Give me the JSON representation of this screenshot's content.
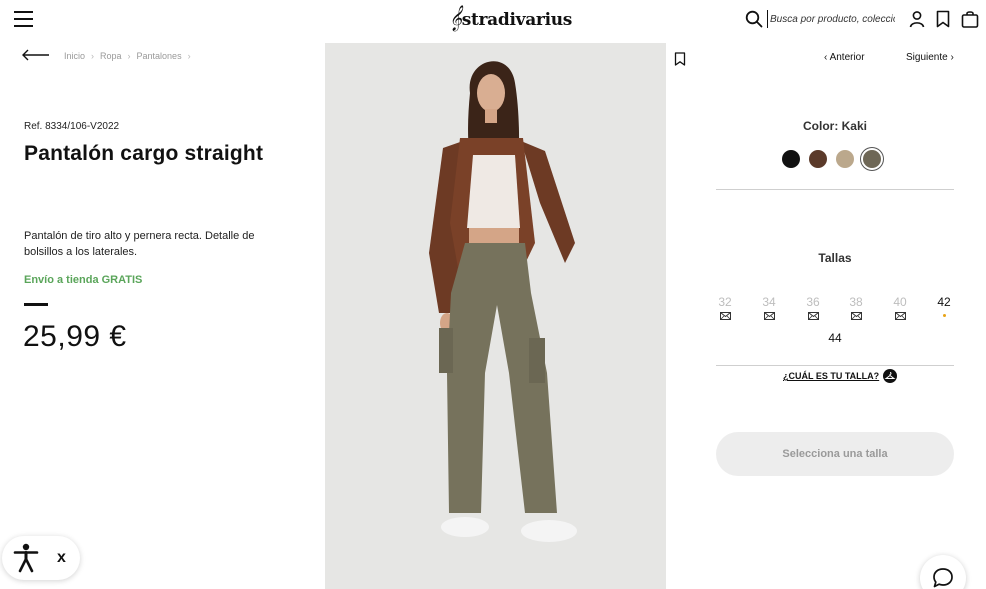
{
  "header": {
    "logo_text": "stradivarius",
    "logo_mark": "𝄞",
    "search_placeholder": "Busca por producto, colección..."
  },
  "breadcrumb": {
    "items": [
      "Inicio",
      "Ropa",
      "Pantalones"
    ]
  },
  "product": {
    "ref": "Ref. 8334/106-V2022",
    "title": "Pantalón cargo straight",
    "description": "Pantalón de tiro alto y pernera recta. Detalle de bolsillos a los laterales.",
    "shipping": "Envío a tienda GRATIS",
    "price": "25,99 €"
  },
  "navigation": {
    "prev_label": "Anterior",
    "next_label": "Siguiente"
  },
  "color": {
    "label": "Color: Kaki",
    "swatches": [
      {
        "name": "black",
        "hex": "#111111"
      },
      {
        "name": "brown",
        "hex": "#5b3a2a"
      },
      {
        "name": "beige",
        "hex": "#bba88c"
      },
      {
        "name": "kaki",
        "hex": "#6e6756",
        "selected": true
      }
    ]
  },
  "sizes": {
    "label": "Tallas",
    "items": [
      {
        "size": "32",
        "available": false,
        "icon": "mail-icon"
      },
      {
        "size": "34",
        "available": false,
        "icon": "mail-icon"
      },
      {
        "size": "36",
        "available": false,
        "icon": "mail-icon"
      },
      {
        "size": "38",
        "available": false,
        "icon": "mail-icon"
      },
      {
        "size": "40",
        "available": false,
        "icon": "mail-icon"
      },
      {
        "size": "42",
        "available": true,
        "icon": "low-stock-dot"
      },
      {
        "size": "44",
        "available": true,
        "icon": ""
      }
    ],
    "guide_label": "¿CUÁL ES TU TALLA?"
  },
  "cta": {
    "select_size_label": "Selecciona una talla"
  },
  "widgets": {
    "close_label": "x"
  },
  "colors": {
    "shipping_green": "#5aa55a",
    "low_stock_dot": "#e8a317",
    "button_bg": "#ededed"
  }
}
